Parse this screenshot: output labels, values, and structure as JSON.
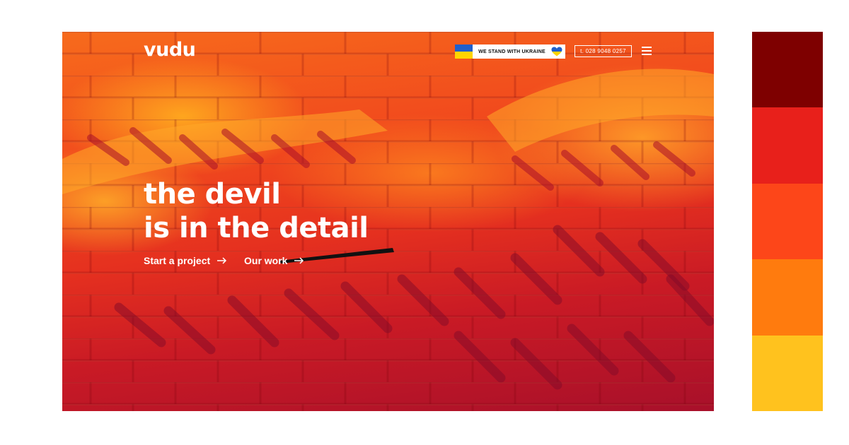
{
  "header": {
    "logo": "vudu",
    "ukraine_banner": {
      "text": "WE STAND WITH UKRAINE",
      "flag_colors": [
        "#1f5fcc",
        "#ffd400"
      ],
      "heart_colors": [
        "#1f5fcc",
        "#ffd400"
      ]
    },
    "phone": "t. 028 9048 0257",
    "menu_icon": "hamburger-menu-icon"
  },
  "hero": {
    "headline_line1": "the devil",
    "headline_line2": "is in the detail",
    "cta_primary": "Start a project",
    "cta_secondary": "Our work",
    "cta_icon": "arrow-right-icon"
  },
  "palette": {
    "colors": [
      "#7e0000",
      "#e8201b",
      "#fd4619",
      "#ff7b0e",
      "#ffc21e"
    ]
  }
}
